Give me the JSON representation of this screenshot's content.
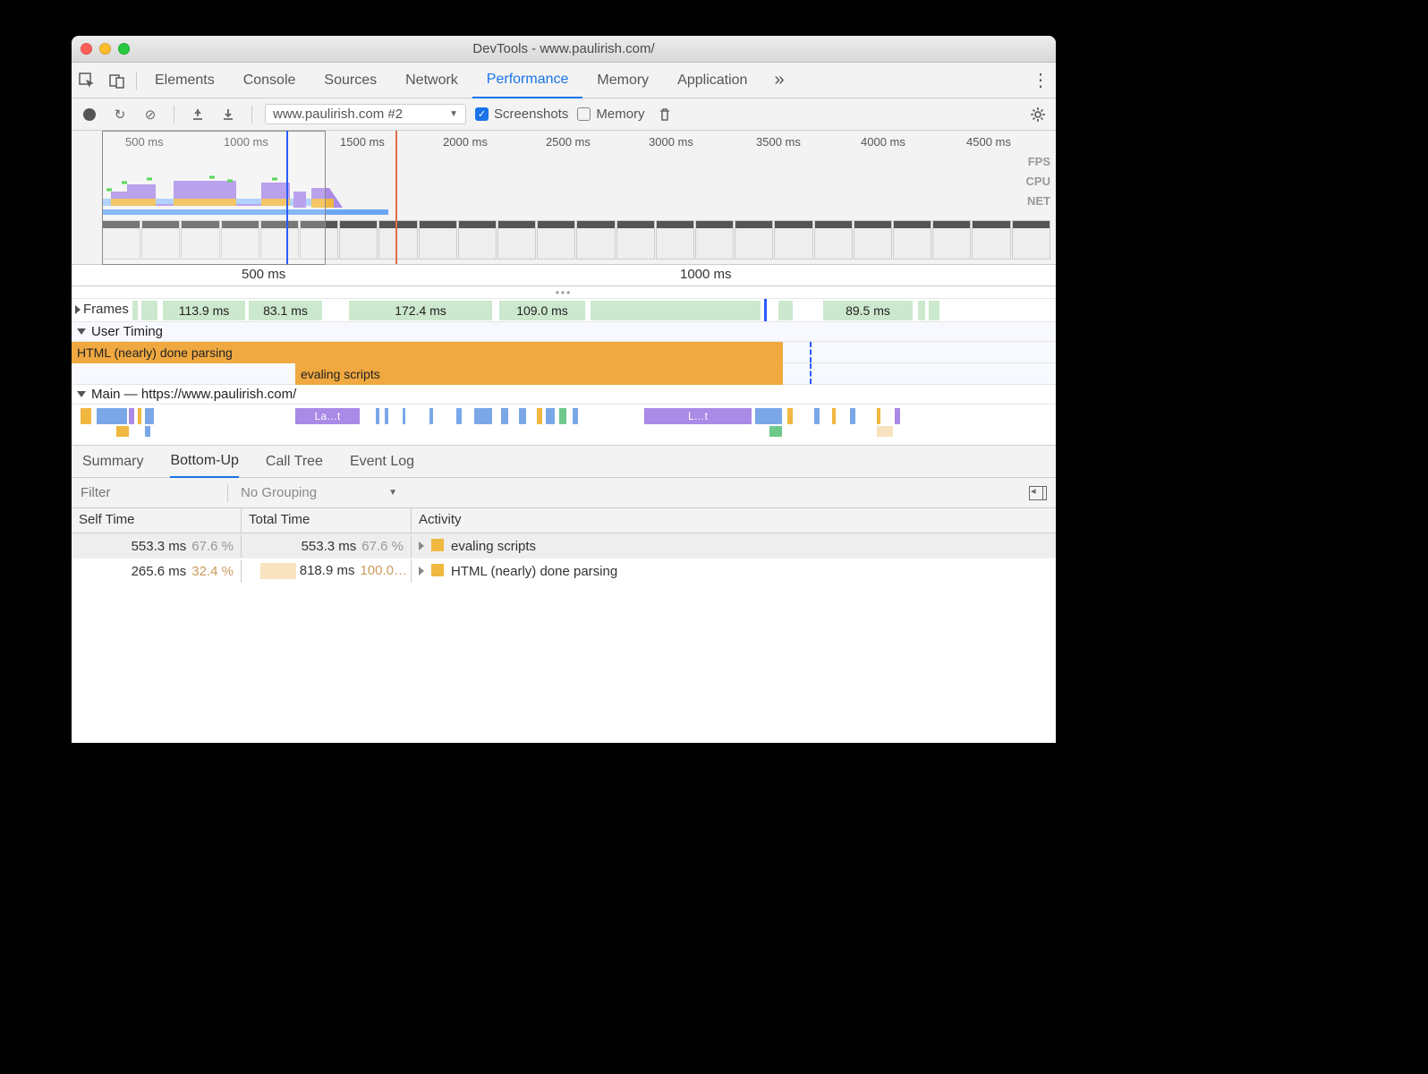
{
  "window_title": "DevTools - www.paulirish.com/",
  "tabs": [
    "Elements",
    "Console",
    "Sources",
    "Network",
    "Performance",
    "Memory",
    "Application"
  ],
  "active_tab": "Performance",
  "toolbar": {
    "recording_select": "www.paulirish.com #2",
    "screenshots_label": "Screenshots",
    "screenshots_checked": true,
    "memory_label": "Memory",
    "memory_checked": false
  },
  "overview": {
    "ticks": [
      "500 ms",
      "1000 ms",
      "1500 ms",
      "2000 ms",
      "2500 ms",
      "3000 ms",
      "3500 ms",
      "4000 ms",
      "4500 ms"
    ],
    "side_labels": [
      "FPS",
      "CPU",
      "NET"
    ]
  },
  "ruler2": [
    "500 ms",
    "1000 ms"
  ],
  "frames": {
    "label": "Frames",
    "blocks": [
      "113.9 ms",
      "83.1 ms",
      "172.4 ms",
      "109.0 ms",
      "89.5 ms"
    ]
  },
  "user_timing": {
    "label": "User Timing",
    "bars": [
      {
        "label": "HTML (nearly) done parsing"
      },
      {
        "label": "evaling scripts"
      }
    ]
  },
  "main": {
    "label": "Main — https://www.paulirish.com/",
    "snips": [
      "La…t",
      "L…t"
    ]
  },
  "detail_tabs": [
    "Summary",
    "Bottom-Up",
    "Call Tree",
    "Event Log"
  ],
  "detail_active": "Bottom-Up",
  "filter_placeholder": "Filter",
  "grouping": "No Grouping",
  "columns": [
    "Self Time",
    "Total Time",
    "Activity"
  ],
  "rows": [
    {
      "self_ms": "553.3 ms",
      "self_pct": "67.6 %",
      "total_ms": "553.3 ms",
      "total_pct": "67.6 %",
      "activity": "evaling scripts",
      "tot_bar": 0.68
    },
    {
      "self_ms": "265.6 ms",
      "self_pct": "32.4 %",
      "total_ms": "818.9 ms",
      "total_pct": "100.0…",
      "activity": "HTML (nearly) done parsing",
      "tot_bar": 1.0
    }
  ]
}
